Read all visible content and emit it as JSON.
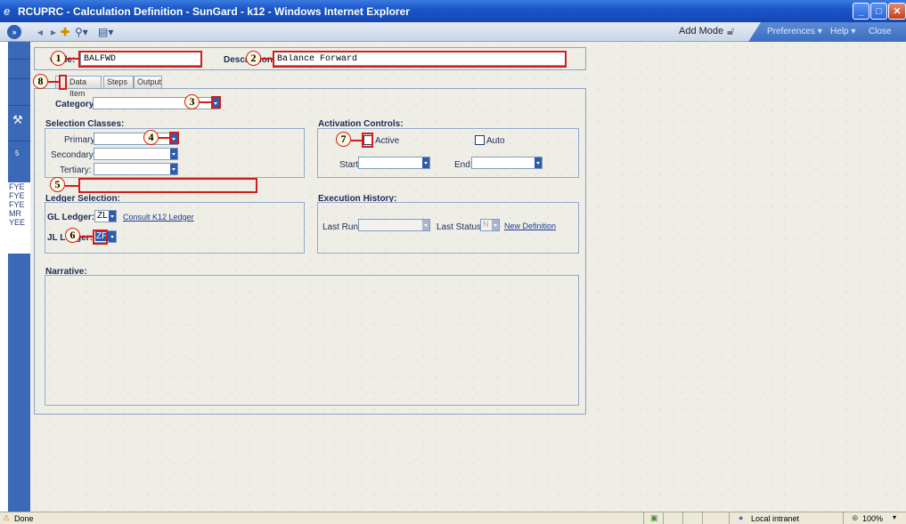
{
  "window": {
    "title": "RCUPRC - Calculation Definition - SunGard - k12 - Windows Internet Explorer",
    "controls": [
      "minimize-icon",
      "maximize-icon",
      "close-icon"
    ]
  },
  "toolbar": {
    "add_mode": "Add Mode",
    "preferences": "Preferences ▾",
    "help": "Help ▾",
    "close": "Close"
  },
  "leftnav": {
    "number": "5",
    "items": [
      "FYE",
      "FYE",
      "FYE",
      "MR",
      "YEE"
    ]
  },
  "form": {
    "code_label": "Code:",
    "code_value": "BALFWD",
    "description_label": "Description:",
    "description_value": "Balance Forward",
    "tabs": [
      "",
      "Data Item",
      "Steps",
      "Output"
    ],
    "category_label": "Category:",
    "category_value": "",
    "selection_classes": {
      "title": "Selection Classes:",
      "primary": "Primary:",
      "secondary": "Secondary:",
      "tertiary": "Tertiary:"
    },
    "activation": {
      "title": "Activation Controls:",
      "active": "Active",
      "auto": "Auto",
      "start": "Start:",
      "end": "End:"
    },
    "ledger": {
      "title": "Ledger Selection:",
      "gl_label": "GL Ledger:",
      "gl_value": "ZL",
      "consult_link": "Consult K12 Ledger",
      "jl_label": "JL Ledger:",
      "jl_value": "ZP"
    },
    "execution": {
      "title": "Execution History:",
      "last_run": "Last Run:",
      "last_status": "Last Status:",
      "last_status_value": "N",
      "new_definition": "New Definition"
    },
    "narrative_label": "Narrative:"
  },
  "callouts": [
    "1",
    "2",
    "3",
    "4",
    "5",
    "6",
    "7",
    "8"
  ],
  "statusbar": {
    "status": "Done",
    "zone": "Local intranet",
    "zoom": "100%"
  }
}
